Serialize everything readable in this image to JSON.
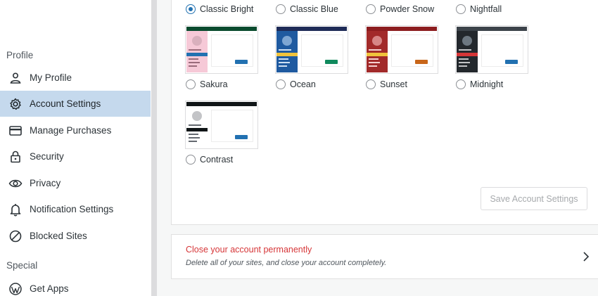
{
  "sidebar": {
    "sections": [
      {
        "heading": "Profile"
      },
      {
        "heading": "Special"
      }
    ],
    "items": [
      {
        "label": "My Profile",
        "icon": "person-icon",
        "active": false
      },
      {
        "label": "Account Settings",
        "icon": "gear-icon",
        "active": true
      },
      {
        "label": "Manage Purchases",
        "icon": "credit-card-icon",
        "active": false
      },
      {
        "label": "Security",
        "icon": "lock-icon",
        "active": false
      },
      {
        "label": "Privacy",
        "icon": "eye-icon",
        "active": false
      },
      {
        "label": "Notification Settings",
        "icon": "bell-icon",
        "active": false
      },
      {
        "label": "Blocked Sites",
        "icon": "block-icon",
        "active": false
      },
      {
        "label": "Get Apps",
        "icon": "wordpress-icon",
        "active": false
      }
    ]
  },
  "color_schemes": {
    "selected": "Classic Bright",
    "options": [
      {
        "label": "Classic Bright"
      },
      {
        "label": "Classic Blue"
      },
      {
        "label": "Powder Snow"
      },
      {
        "label": "Nightfall"
      },
      {
        "label": "Sakura",
        "colors": {
          "bar": "#0a4b2e",
          "side": "#f6c9d7",
          "hl": "#2271b1",
          "line": "#9a6c7b",
          "btn": "#2271b1",
          "avatar": "#d9b0bd"
        }
      },
      {
        "label": "Ocean",
        "colors": {
          "bar": "#1e2b57",
          "side": "#1f5aa0",
          "hl": "#f0c33c",
          "line": "#cfe0f3",
          "btn": "#108a5d",
          "avatar": "#7ea6d3"
        }
      },
      {
        "label": "Sunset",
        "colors": {
          "bar": "#8c1d1f",
          "side": "#a22a2a",
          "hl": "#f0c33c",
          "line": "#f5d0d0",
          "btn": "#c8661a",
          "avatar": "#d78686"
        }
      },
      {
        "label": "Midnight",
        "colors": {
          "bar": "#3c434a",
          "side": "#23282d",
          "hl": "#d63638",
          "line": "#c3c4c7",
          "btn": "#2271b1",
          "avatar": "#6c7781"
        }
      },
      {
        "label": "Contrast",
        "colors": {
          "bar": "#101517",
          "side": "#ffffff",
          "hl": "#101517",
          "line": "#646970",
          "btn": "#2271b1",
          "avatar": "#c3c4c7"
        }
      }
    ]
  },
  "actions": {
    "save_label": "Save Account Settings"
  },
  "close_account": {
    "title": "Close your account permanently",
    "description": "Delete all of your sites, and close your account completely."
  }
}
